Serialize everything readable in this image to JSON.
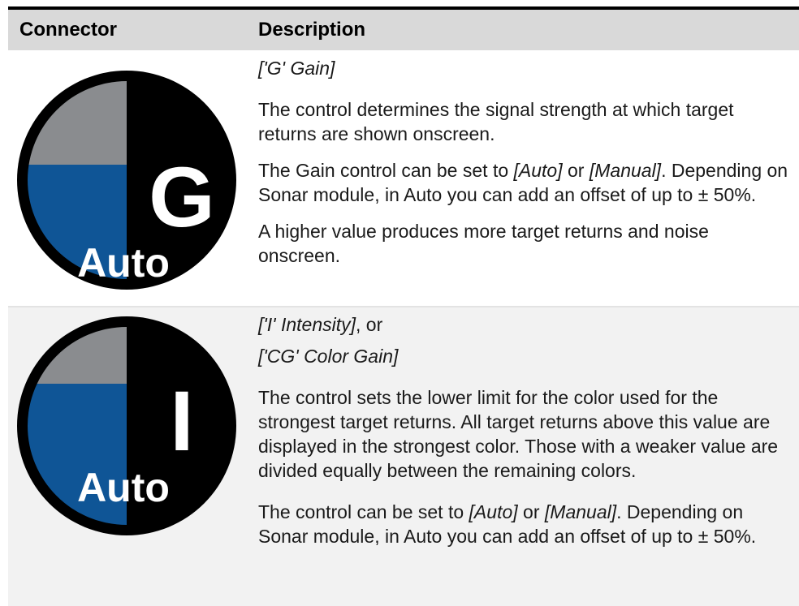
{
  "table": {
    "headers": {
      "connector": "Connector",
      "description": "Description"
    },
    "rows": [
      {
        "icon": {
          "name": "gain-auto-icon",
          "letter": "G",
          "mode": "Auto",
          "colors": {
            "ring": "#000000",
            "grey": "#8a8c8f",
            "blue": "#0f5596",
            "black": "#000000",
            "text": "#ffffff"
          }
        },
        "title": "['G' Gain]",
        "para1": "The control determines the signal strength at which target returns are shown onscreen.",
        "para2": {
          "prefix": "The Gain control can be set to ",
          "opt1": "[Auto]",
          "mid": " or ",
          "opt2": "[Manual]",
          "suffix": ". Depending on Sonar module, in Auto you can add an offset of up to ± 50%."
        },
        "para3": "A higher value produces more target returns and noise onscreen."
      },
      {
        "icon": {
          "name": "intensity-auto-icon",
          "letter": "I",
          "mode": "Auto",
          "colors": {
            "ring": "#000000",
            "grey": "#8a8c8f",
            "blue": "#0f5596",
            "black": "#000000",
            "text": "#ffffff"
          }
        },
        "title1": "['I' Intensity]",
        "title1_suffix": ", or",
        "title2": "['CG' Color Gain]",
        "para1": "The control sets the lower limit for the color used for the strongest target returns. All target returns above this value are displayed in the strongest color. Those with a weaker value are divided equally between the remaining colors.",
        "para2": {
          "prefix": "The control can be set to ",
          "opt1": "[Auto]",
          "mid": " or ",
          "opt2": "[Manual]",
          "suffix": ". Depending on Sonar module, in Auto you can add an offset of up to ± 50%."
        }
      }
    ]
  }
}
